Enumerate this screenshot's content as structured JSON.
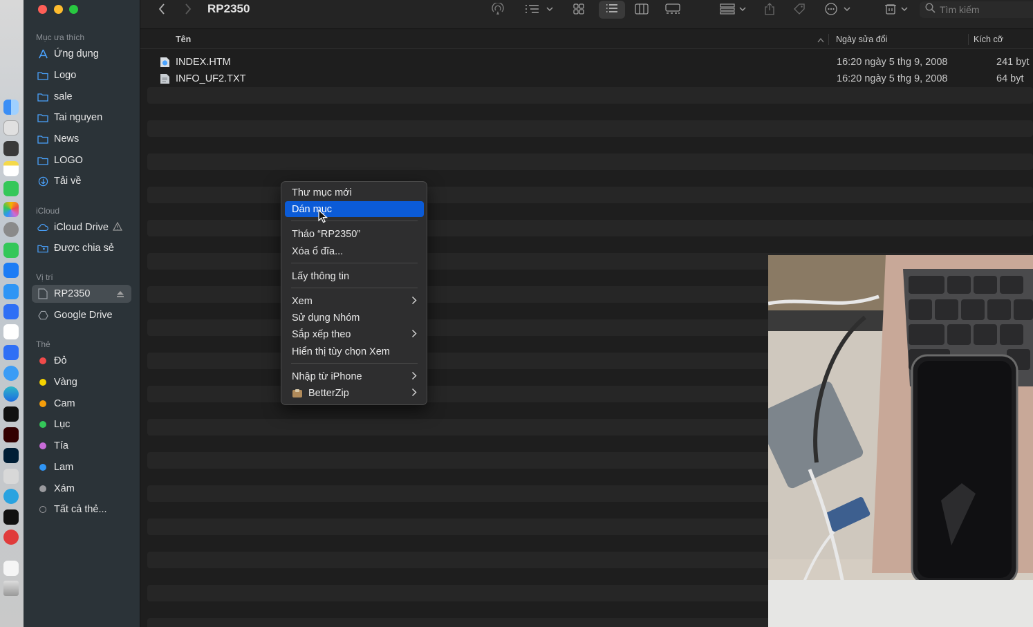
{
  "window": {
    "title": "RP2350"
  },
  "toolbar": {
    "search_placeholder": "Tìm kiếm",
    "icons": [
      "back-icon",
      "forward-icon",
      "airdrop-icon",
      "list-options-icon",
      "icon-view-icon",
      "list-view-icon",
      "column-view-icon",
      "gallery-view-icon",
      "group-icon",
      "share-icon",
      "tag-icon",
      "more-icon",
      "action-icon",
      "search-icon"
    ]
  },
  "sidebar": {
    "favorites_heading": "Mục ưa thích",
    "favorites": [
      {
        "label": "Ứng dụng",
        "icon": "applications-icon"
      },
      {
        "label": "Logo",
        "icon": "folder-icon"
      },
      {
        "label": "sale",
        "icon": "folder-icon"
      },
      {
        "label": "Tai nguyen",
        "icon": "folder-icon"
      },
      {
        "label": "News",
        "icon": "folder-icon"
      },
      {
        "label": "LOGO",
        "icon": "folder-icon"
      },
      {
        "label": "Tải về",
        "icon": "downloads-icon"
      }
    ],
    "icloud_heading": "iCloud",
    "icloud": [
      {
        "label": "iCloud Drive",
        "icon": "cloud-icon"
      },
      {
        "label": "Được chia sẻ",
        "icon": "shared-folder-icon"
      }
    ],
    "locations_heading": "Vị trí",
    "locations": [
      {
        "label": "RP2350",
        "icon": "drive-icon"
      },
      {
        "label": "Google Drive",
        "icon": "google-drive-icon"
      }
    ],
    "tags_heading": "Thẻ",
    "tags": [
      {
        "label": "Đỏ",
        "color": "#f04a4a"
      },
      {
        "label": "Vàng",
        "color": "#f5d300"
      },
      {
        "label": "Cam",
        "color": "#f59e0b"
      },
      {
        "label": "Lục",
        "color": "#34c759"
      },
      {
        "label": "Tía",
        "color": "#c86bd8"
      },
      {
        "label": "Lam",
        "color": "#2f95f5"
      },
      {
        "label": "Xám",
        "color": "#9a9a9e"
      }
    ],
    "all_tags": "Tất cả thẻ..."
  },
  "columns": {
    "name": "Tên",
    "date": "Ngày sửa đổi",
    "size": "Kích cỡ"
  },
  "files": [
    {
      "name": "INDEX.HTM",
      "date": "16:20 ngày 5 thg 9, 2008",
      "size": "241 byt"
    },
    {
      "name": "INFO_UF2.TXT",
      "date": "16:20 ngày 5 thg 9, 2008",
      "size": "64 byt"
    }
  ],
  "context_menu": {
    "new_folder": "Thư mục mới",
    "paste": "Dán mục",
    "eject": "Tháo “RP2350”",
    "erase": "Xóa ổ đĩa...",
    "get_info": "Lấy thông tin",
    "view": "Xem",
    "use_groups": "Sử dụng Nhóm",
    "sort_by": "Sắp xếp theo",
    "show_view_options": "Hiển thị tùy chọn Xem",
    "import_iphone": "Nhập từ iPhone",
    "betterzip": "BetterZip"
  },
  "colors": {
    "highlight": "#0b5bd7",
    "sidebar": "#2b3338",
    "window": "#1e1e1e"
  }
}
